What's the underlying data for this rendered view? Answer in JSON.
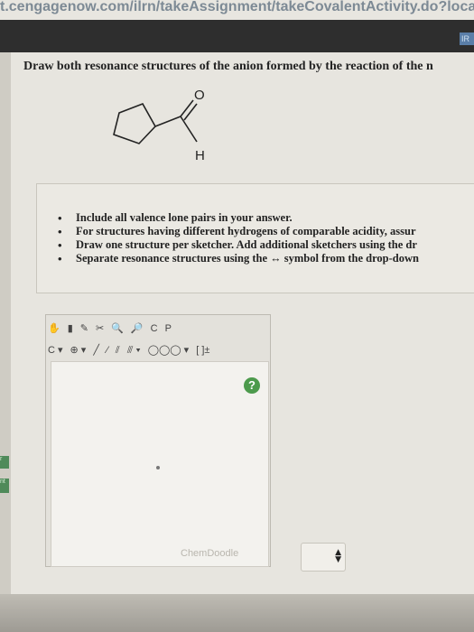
{
  "browser": {
    "url_fragment": "t.cengagenow.com/ilrn/takeAssignment/takeCovalentActivity.do?locato"
  },
  "corner_button_label": "IR",
  "left_tabs": [
    "r",
    "nt"
  ],
  "question": {
    "title": "Draw both resonance structures of the anion formed by the reaction of the n",
    "molecule_labels": {
      "oxygen": "O",
      "hydrogen": "H"
    }
  },
  "instructions": [
    "Include all valence lone pairs in your answer.",
    "For structures having different hydrogens of comparable acidity, assur",
    "Draw one structure per sketcher. Add additional sketchers using the dr",
    "Separate resonance structures using the ↔ symbol from the drop-down"
  ],
  "sketcher": {
    "toolbar1": [
      "C",
      "P"
    ],
    "toolbar2": {
      "atom_label": "C",
      "charge_label": "⊕",
      "bracket_label": "[ ]±"
    },
    "help_label": "?",
    "brand": "ChemDoodle"
  },
  "select": {
    "arrows_up": "▲",
    "arrows_down": "▼"
  }
}
